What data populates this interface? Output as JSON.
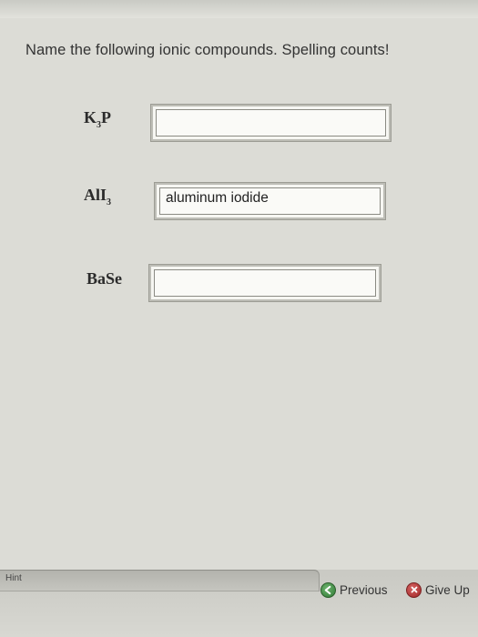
{
  "question": {
    "text": "Name the following ionic compounds. Spelling counts!"
  },
  "items": [
    {
      "formula_main": "K",
      "formula_sub": "3",
      "formula_tail": "P",
      "answer_value": "",
      "answer_placeholder": ""
    },
    {
      "formula_main": "AlI",
      "formula_sub": "3",
      "formula_tail": "",
      "answer_value": "aluminum iodide",
      "answer_placeholder": ""
    },
    {
      "formula_main": "BaSe",
      "formula_sub": "",
      "formula_tail": "",
      "answer_value": "",
      "answer_placeholder": ""
    }
  ],
  "footer": {
    "hint_label": "Hint",
    "previous_label": "Previous",
    "giveup_label": "Give Up"
  },
  "colors": {
    "previous_icon": "#2f7b35",
    "giveup_icon": "#a02525"
  },
  "icons": {
    "previous": "arrow-left-circle-icon",
    "giveup": "x-circle-icon"
  }
}
